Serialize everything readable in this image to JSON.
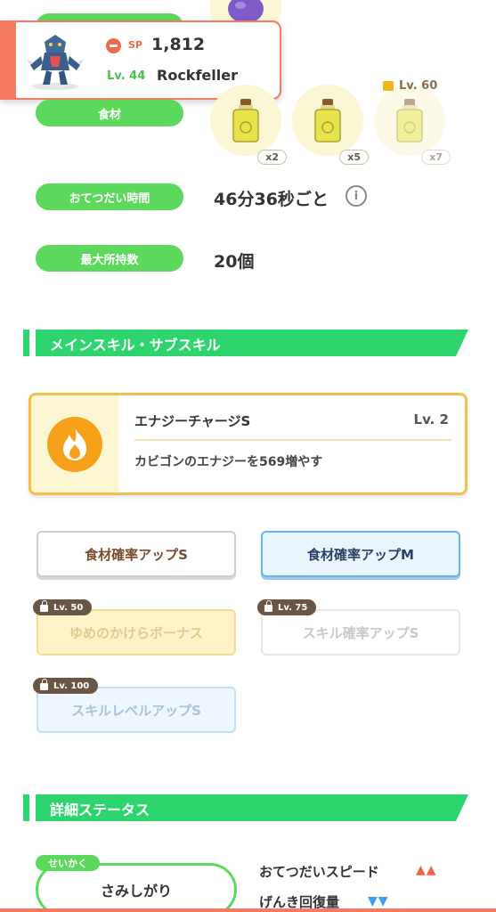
{
  "pokemon": {
    "sp_label": "SP",
    "sp_value": "1,812",
    "level": "Lv. 44",
    "name": "Rockfeller"
  },
  "info_rows": {
    "ingredients_label": "食材",
    "help_time_label": "おてつだい時間",
    "help_time_value": "46分36秒ごと",
    "max_carry_label": "最大所持数",
    "max_carry_value": "20個"
  },
  "ingredients": [
    {
      "count": "x2",
      "locked": false
    },
    {
      "count": "x5",
      "locked": false
    },
    {
      "count": "x7",
      "locked": true,
      "unlock_level": "Lv. 60"
    }
  ],
  "sections": {
    "skills_title": "メインスキル・サブスキル",
    "details_title": "詳細ステータス"
  },
  "main_skill": {
    "name": "エナジーチャージS",
    "level": "Lv. 2",
    "description": "カビゴンのエナジーを569増やす"
  },
  "sub_skills": [
    {
      "label": "食材確率アップS",
      "style": "plain",
      "lock": ""
    },
    {
      "label": "食材確率アップM",
      "style": "blue",
      "lock": ""
    },
    {
      "label": "ゆめのかけらボーナス",
      "style": "gold-locked",
      "lock": "Lv. 50"
    },
    {
      "label": "スキル確率アップS",
      "style": "gray-locked",
      "lock": "Lv. 75"
    },
    {
      "label": "スキルレベルアップS",
      "style": "blue-locked",
      "lock": "Lv. 100"
    }
  ],
  "nature": {
    "tag": "せいかく",
    "value": "さみしがり",
    "up_stat": "おてつだいスピード",
    "down_stat": "げんき回復量",
    "up_arrows": "▲▲",
    "down_arrows": "▼▼"
  },
  "colors": {
    "accent_green": "#2ed56e",
    "pill_green": "#5cd95c",
    "card_orange": "#f47b61",
    "up_red": "#f0634a",
    "down_blue": "#3aa0ef"
  }
}
